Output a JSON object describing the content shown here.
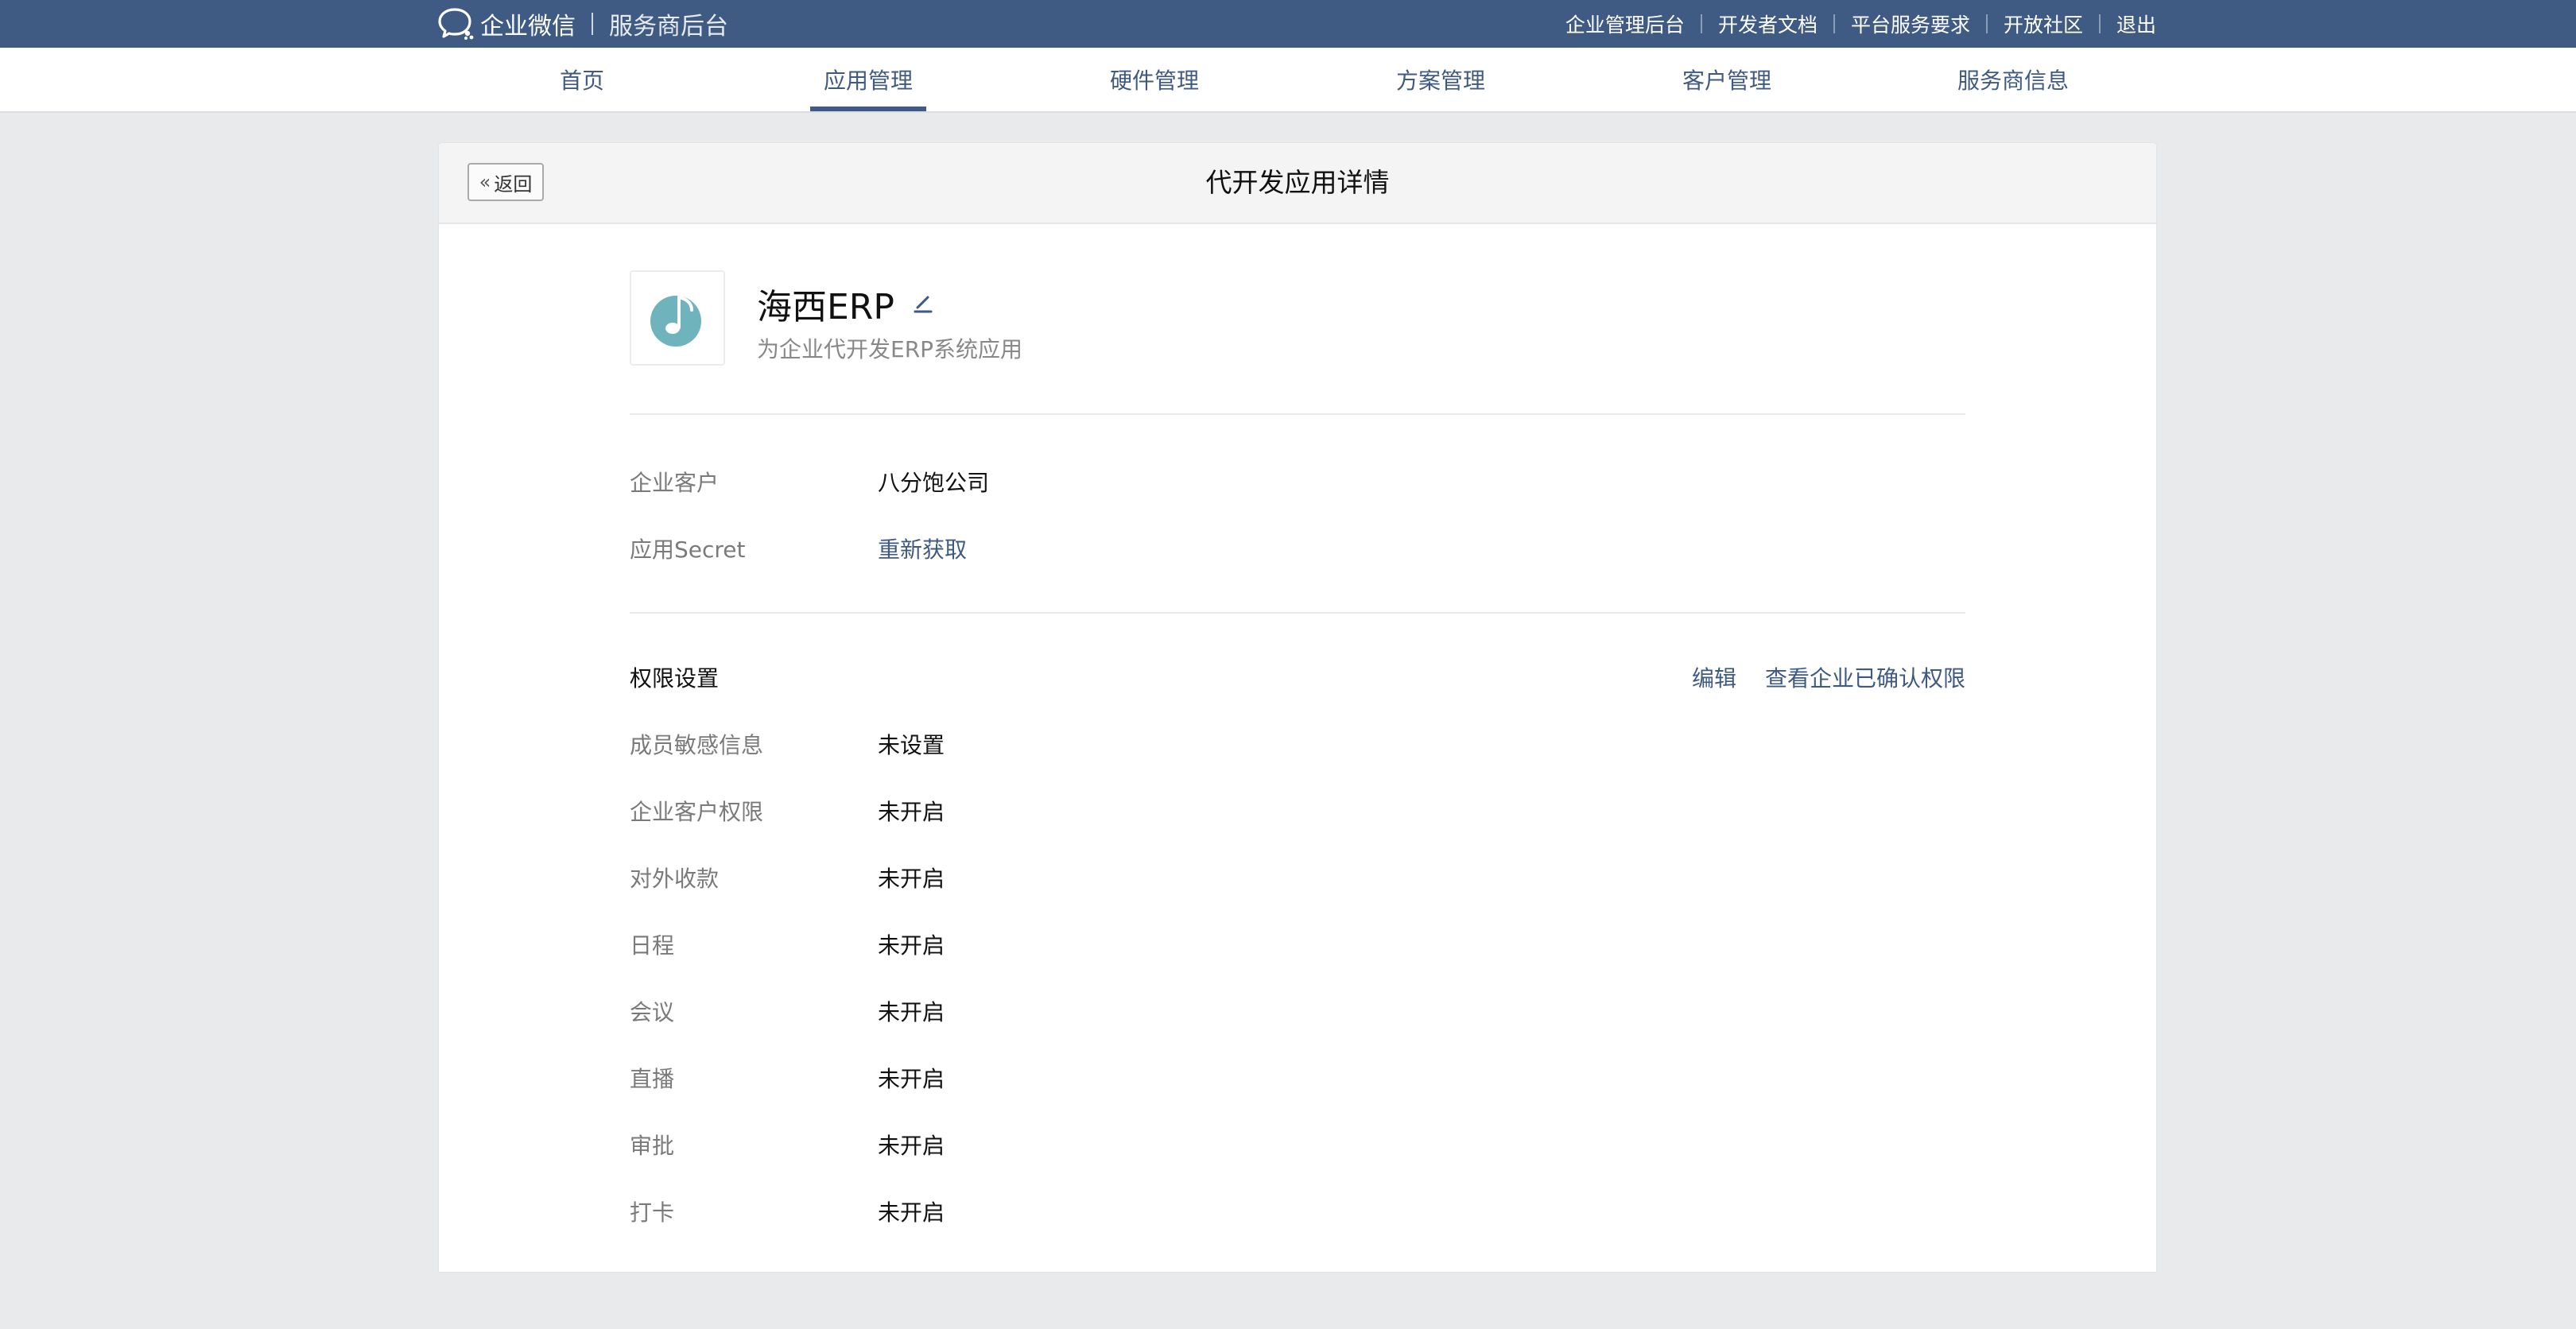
{
  "topbar": {
    "brand_name": "企业微信",
    "brand_sub": "服务商后台",
    "links": [
      "企业管理后台",
      "开发者文档",
      "平台服务要求",
      "开放社区",
      "退出"
    ]
  },
  "nav": {
    "tabs": [
      {
        "label": "首页"
      },
      {
        "label": "应用管理"
      },
      {
        "label": "硬件管理"
      },
      {
        "label": "方案管理"
      },
      {
        "label": "客户管理"
      },
      {
        "label": "服务商信息"
      }
    ],
    "active": "应用管理"
  },
  "header": {
    "back_label": "返回",
    "title": "代开发应用详情"
  },
  "app": {
    "name": "海西ERP",
    "desc": "为企业代开发ERP系统应用"
  },
  "basic": {
    "customer_label": "企业客户",
    "customer_value": "八分饱公司",
    "secret_label": "应用Secret",
    "secret_action": "重新获取"
  },
  "permissions": {
    "title": "权限设置",
    "edit_label": "编辑",
    "view_label": "查看企业已确认权限",
    "items": [
      {
        "label": "成员敏感信息",
        "value": "未设置"
      },
      {
        "label": "企业客户权限",
        "value": "未开启"
      },
      {
        "label": "对外收款",
        "value": "未开启"
      },
      {
        "label": "日程",
        "value": "未开启"
      },
      {
        "label": "会议",
        "value": "未开启"
      },
      {
        "label": "直播",
        "value": "未开启"
      },
      {
        "label": "审批",
        "value": "未开启"
      },
      {
        "label": "打卡",
        "value": "未开启"
      }
    ]
  },
  "colors": {
    "topbar_bg": "#3f5b84",
    "link": "#3f5a82",
    "app_logo": "#6fb3bd"
  }
}
